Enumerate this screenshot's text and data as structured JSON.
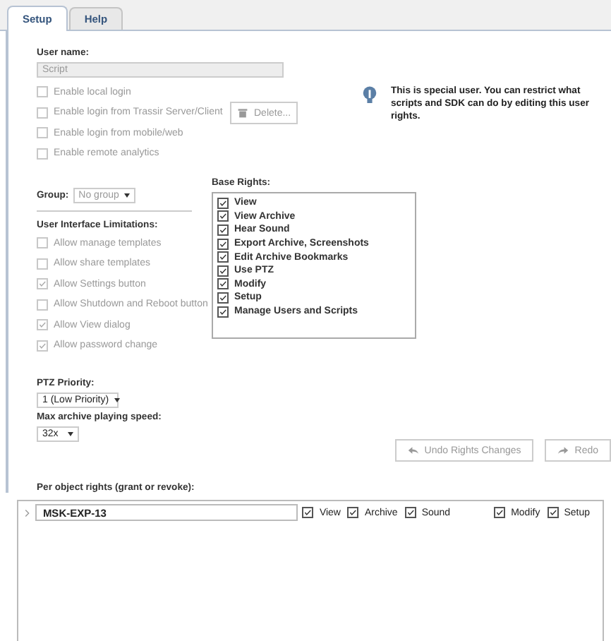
{
  "tabs": [
    {
      "label": "Setup",
      "selected": true
    },
    {
      "label": "Help",
      "selected": false
    }
  ],
  "user_name": {
    "label": "User name:",
    "value": "Script",
    "disabled": true
  },
  "login_options": [
    {
      "label": "Enable local login",
      "checked": false,
      "disabled": true
    },
    {
      "label": "Enable login from Trassir Server/Client",
      "checked": false,
      "disabled": true
    },
    {
      "label": "Enable login from mobile/web",
      "checked": false,
      "disabled": true
    },
    {
      "label": "Enable remote analytics",
      "checked": false,
      "disabled": true
    }
  ],
  "delete_button": {
    "label": "Delete...",
    "disabled": true
  },
  "info": {
    "text": "This is special user. You can restrict what scripts and SDK can do by editing this user rights."
  },
  "group": {
    "label": "Group:",
    "value": "No group",
    "disabled": true
  },
  "ui_limitations": {
    "title": "User Interface Limitations:",
    "items": [
      {
        "label": "Allow manage templates",
        "checked": false,
        "disabled": true
      },
      {
        "label": "Allow share templates",
        "checked": false,
        "disabled": true
      },
      {
        "label": "Allow Settings button",
        "checked": true,
        "disabled": true
      },
      {
        "label": "Allow Shutdown and Reboot button",
        "checked": false,
        "disabled": true
      },
      {
        "label": "Allow View dialog",
        "checked": true,
        "disabled": true
      },
      {
        "label": "Allow password change",
        "checked": true,
        "disabled": true
      }
    ]
  },
  "base_rights": {
    "title": "Base Rights:",
    "items": [
      {
        "label": "View",
        "checked": true
      },
      {
        "label": "View Archive",
        "checked": true
      },
      {
        "label": "Hear Sound",
        "checked": true
      },
      {
        "label": "Export Archive, Screenshots",
        "checked": true
      },
      {
        "label": "Edit Archive Bookmarks",
        "checked": true
      },
      {
        "label": "Use PTZ",
        "checked": true
      },
      {
        "label": "Modify",
        "checked": true
      },
      {
        "label": "Setup",
        "checked": true
      },
      {
        "label": "Manage Users and Scripts",
        "checked": true
      }
    ]
  },
  "ptz_priority": {
    "label": "PTZ Priority:",
    "value": "1 (Low Priority)"
  },
  "max_speed": {
    "label": "Max archive playing speed:",
    "value": "32x"
  },
  "undo_button": {
    "label": "Undo Rights Changes",
    "disabled": true
  },
  "redo_button": {
    "label": "Redo",
    "disabled": true
  },
  "per_object": {
    "title": "Per object rights (grant or revoke):",
    "rows": [
      {
        "name": "MSK-EXP-13",
        "expanded": false,
        "rights": [
          {
            "label": "View",
            "checked": true
          },
          {
            "label": "Archive",
            "checked": true
          },
          {
            "label": "Sound",
            "checked": true
          },
          {
            "label": "Modify",
            "checked": true
          },
          {
            "label": "Setup",
            "checked": true
          }
        ]
      }
    ]
  }
}
